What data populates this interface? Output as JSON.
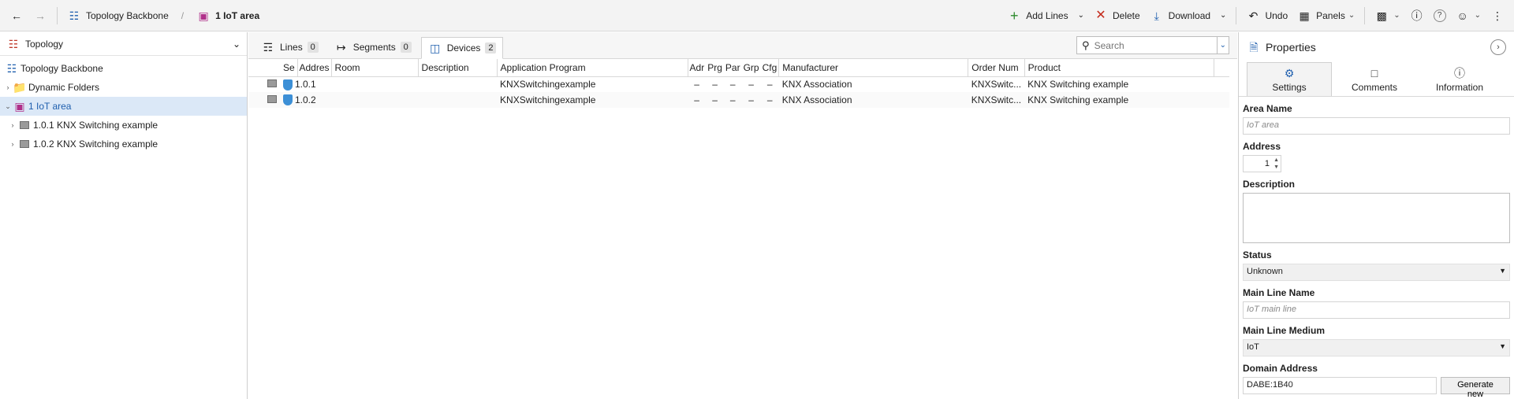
{
  "toolbar": {
    "back_icon": "arrow-left-icon",
    "forward_icon": "arrow-right-icon",
    "breadcrumb_root": "Topology Backbone",
    "breadcrumb_current": "1 IoT area",
    "add_lines": "Add Lines",
    "delete": "Delete",
    "download": "Download",
    "undo": "Undo",
    "panels": "Panels"
  },
  "tree": {
    "header": "Topology",
    "items": [
      {
        "label": "Topology Backbone"
      },
      {
        "label": "Dynamic Folders"
      },
      {
        "label": "1 IoT area"
      },
      {
        "label": "1.0.1 KNX Switching example"
      },
      {
        "label": "1.0.2 KNX Switching example"
      }
    ]
  },
  "tabs": [
    {
      "label": "Lines",
      "count": "0"
    },
    {
      "label": "Segments",
      "count": "0"
    },
    {
      "label": "Devices",
      "count": "2"
    }
  ],
  "search": {
    "placeholder": "Search"
  },
  "devices": {
    "columns": [
      "Se",
      "Addres",
      "Room",
      "Description",
      "Application Program",
      "Adr",
      "Prg",
      "Par",
      "Grp",
      "Cfg",
      "Manufacturer",
      "Order Num",
      "Product"
    ],
    "rows": [
      {
        "address": "1.0.1",
        "room": "",
        "description": "",
        "app": "KNXSwitchingexample",
        "adr": "–",
        "prg": "–",
        "par": "–",
        "grp": "–",
        "cfg": "–",
        "manufacturer": "KNX Association",
        "order": "KNXSwitc...",
        "product": "KNX Switching example"
      },
      {
        "address": "1.0.2",
        "room": "",
        "description": "",
        "app": "KNXSwitchingexample",
        "adr": "–",
        "prg": "–",
        "par": "–",
        "grp": "–",
        "cfg": "–",
        "manufacturer": "KNX Association",
        "order": "KNXSwitc...",
        "product": "KNX Switching example"
      }
    ]
  },
  "properties": {
    "title": "Properties",
    "tabs": [
      "Settings",
      "Comments",
      "Information"
    ],
    "area_name_label": "Area Name",
    "area_name_placeholder": "IoT area",
    "address_label": "Address",
    "address_value": "1",
    "description_label": "Description",
    "status_label": "Status",
    "status_value": "Unknown",
    "main_line_name_label": "Main Line Name",
    "main_line_name_placeholder": "IoT main line",
    "main_line_medium_label": "Main Line Medium",
    "main_line_medium_value": "IoT",
    "domain_address_label": "Domain Address",
    "domain_address_value": "DABE:1B40",
    "generate_new": "Generate new"
  },
  "colors": {
    "accent": "#1f5fae",
    "selection": "#dbe8f7",
    "area_icon": "#b0308a"
  }
}
